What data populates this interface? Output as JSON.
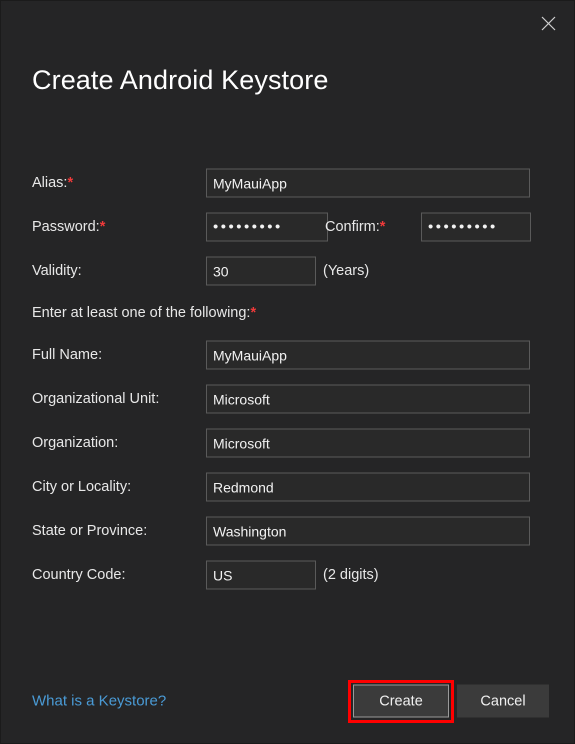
{
  "dialog": {
    "title": "Create Android Keystore",
    "close_icon": "close-icon"
  },
  "form": {
    "section_note": "Enter at least one of the following:",
    "required_marker": "*",
    "rows": [
      {
        "label": "Alias:",
        "required": true,
        "value": "MyMauiApp"
      },
      {
        "label": "Password:",
        "required": true,
        "value": "•••••••••"
      },
      {
        "label": "Confirm:",
        "required": true,
        "value": "•••••••••"
      },
      {
        "label": "Validity:",
        "required": false,
        "value": "30",
        "suffix": "(Years)"
      },
      {
        "label": "Full Name:",
        "required": false,
        "value": "MyMauiApp"
      },
      {
        "label": "Organizational Unit:",
        "required": false,
        "value": "Microsoft"
      },
      {
        "label": "Organization:",
        "required": false,
        "value": "Microsoft"
      },
      {
        "label": "City or Locality:",
        "required": false,
        "value": "Redmond"
      },
      {
        "label": "State or Province:",
        "required": false,
        "value": "Washington"
      },
      {
        "label": "Country Code:",
        "required": false,
        "value": "US",
        "suffix": "(2 digits)"
      }
    ]
  },
  "footer": {
    "help_link": "What is a Keystore?",
    "create_label": "Create",
    "cancel_label": "Cancel"
  },
  "colors": {
    "background": "#252526",
    "field_background": "#292929",
    "field_border": "#5a5a5a",
    "required_red": "#f03a3a",
    "link_blue": "#4a9bd6",
    "button_face": "#3b3b3b",
    "annotation_red": "#ff0000",
    "text": "#e8e8e8"
  }
}
